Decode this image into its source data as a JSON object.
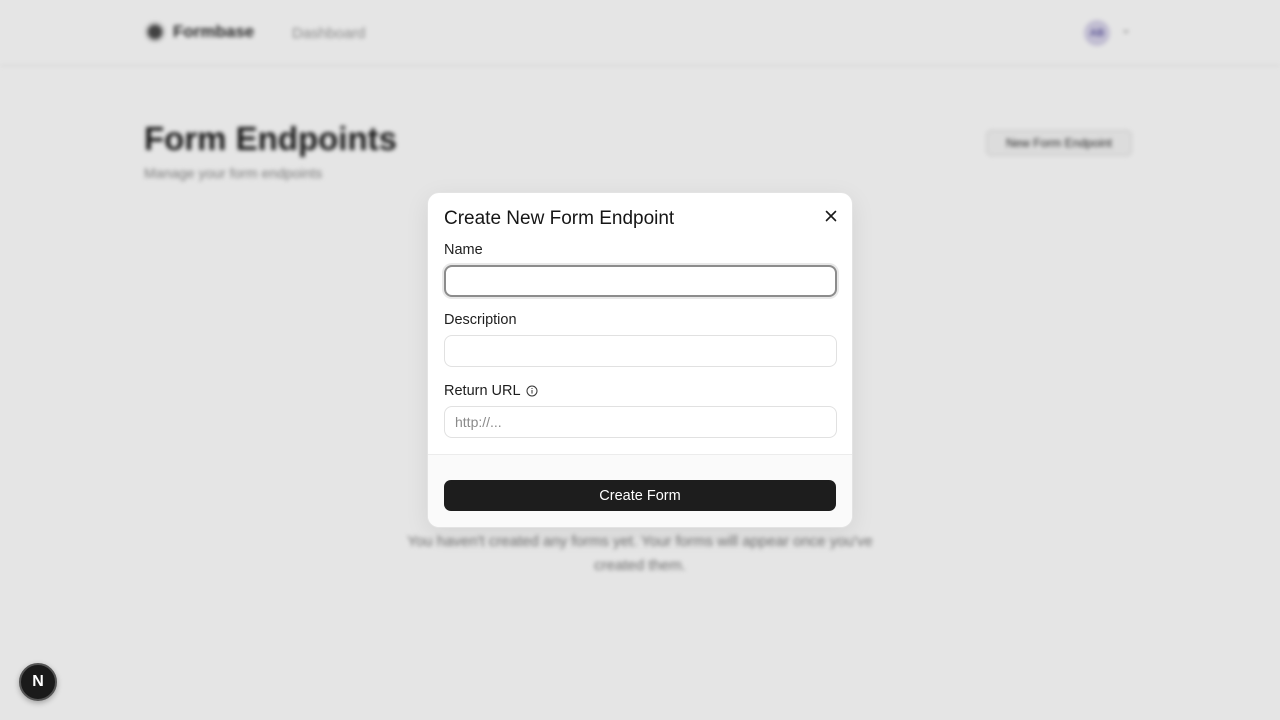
{
  "app": {
    "brand_name": "Formbase",
    "nav_dashboard": "Dashboard",
    "avatar_initials": "AB"
  },
  "page": {
    "title": "Form Endpoints",
    "subtitle": "Manage your form endpoints",
    "new_button_label": "New Form Endpoint",
    "empty_state": "You haven't created any forms yet. Your forms will appear once you've created them."
  },
  "modal": {
    "title": "Create New Form Endpoint",
    "fields": {
      "name": {
        "label": "Name",
        "value": "",
        "placeholder": ""
      },
      "description": {
        "label": "Description",
        "value": "",
        "placeholder": ""
      },
      "return_url": {
        "label": "Return URL",
        "value": "",
        "placeholder": "http://..."
      }
    },
    "submit_label": "Create Form"
  },
  "dev_badge": {
    "letter": "N"
  },
  "icons": {
    "close": "close-icon",
    "info": "info-icon",
    "chevron": "chevron-down-icon"
  },
  "colors": {
    "primary_button": "#1d1d1d",
    "backdrop": "#e5e5e5"
  }
}
